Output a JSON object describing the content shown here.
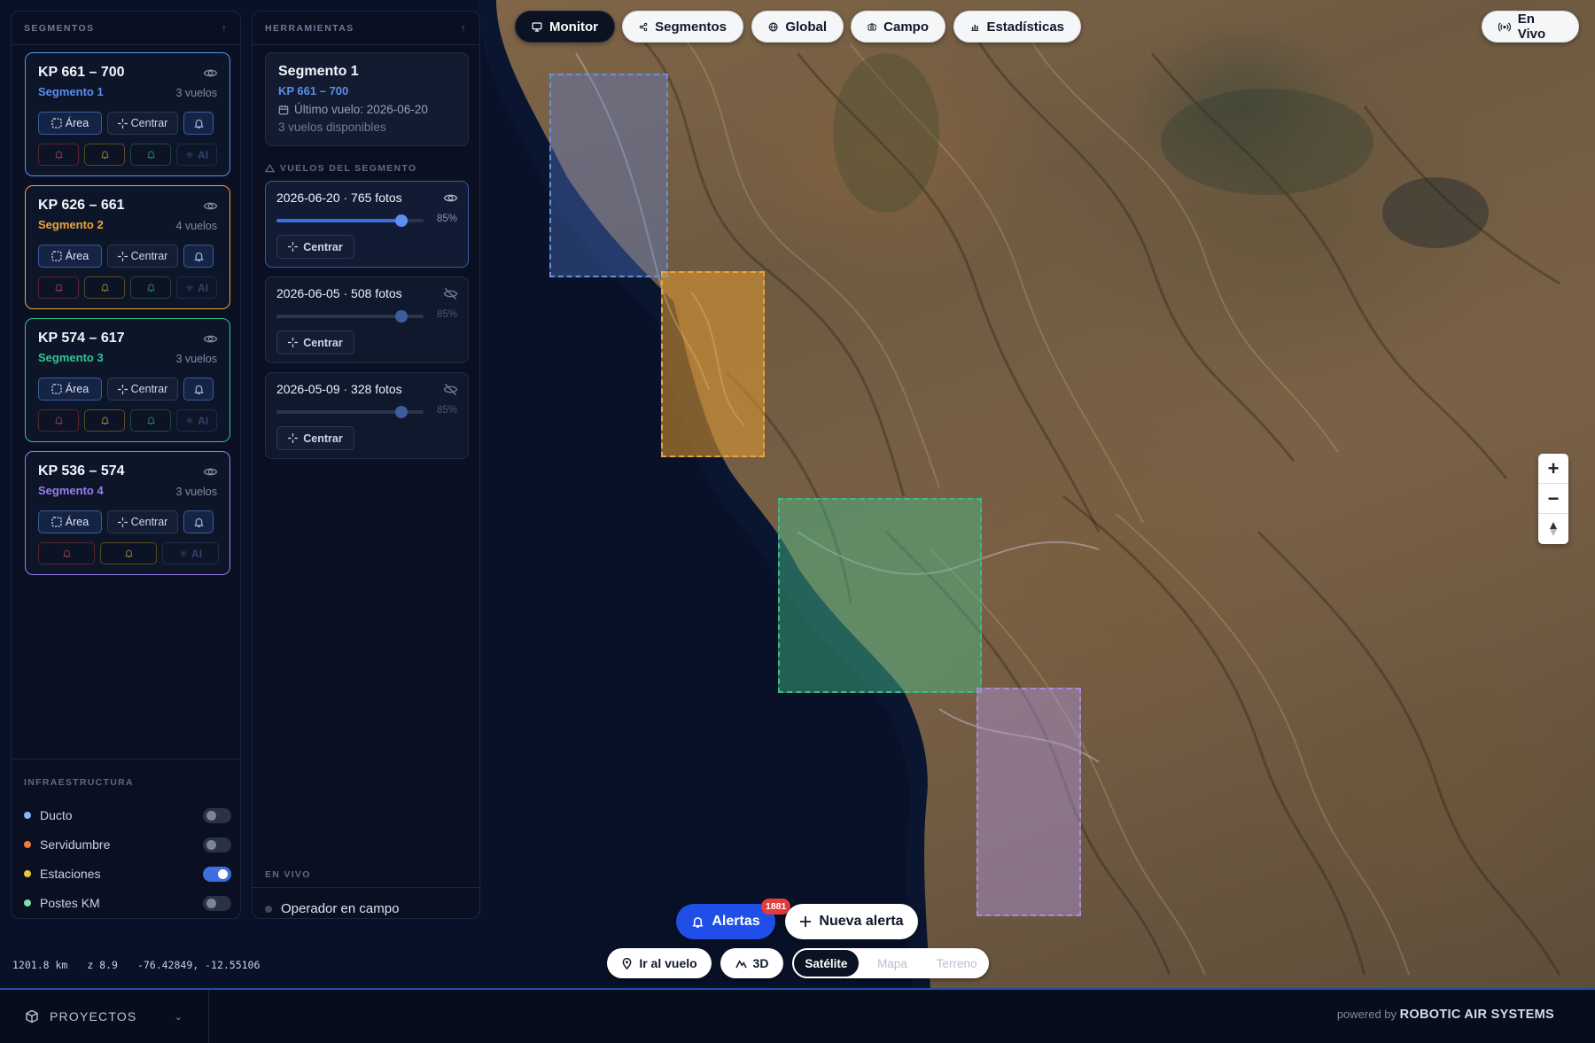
{
  "top_nav": {
    "tabs": [
      {
        "label": "Monitor",
        "icon": "monitor-icon",
        "active": true
      },
      {
        "label": "Segmentos",
        "icon": "share-icon",
        "active": false
      },
      {
        "label": "Global",
        "icon": "globe-icon",
        "active": false
      },
      {
        "label": "Campo",
        "icon": "camera-icon",
        "active": false
      },
      {
        "label": "Estadísticas",
        "icon": "bar-chart-icon",
        "active": false
      }
    ],
    "live_button": "En Vivo"
  },
  "segments_panel": {
    "title": "SEGMENTOS",
    "area_label": "Área",
    "center_label": "Centrar",
    "ai_label": "AI",
    "segments": [
      {
        "kp": "KP 661 – 700",
        "name": "Segmento 1",
        "flights": "3 vuelos",
        "color": "#5b8ef0"
      },
      {
        "kp": "KP 626 – 661",
        "name": "Segmento 2",
        "flights": "4 vuelos",
        "color": "#f0a43a"
      },
      {
        "kp": "KP 574 – 617",
        "name": "Segmento 3",
        "flights": "3 vuelos",
        "color": "#35c48d"
      },
      {
        "kp": "KP 536 – 574",
        "name": "Segmento 4",
        "flights": "3 vuelos",
        "color": "#9a7cf0"
      }
    ],
    "infra_title": "INFRAESTRUCTURA",
    "infra_items": [
      {
        "label": "Ducto",
        "color": "#8fb3f5",
        "on": false
      },
      {
        "label": "Servidumbre",
        "color": "#f07a3a",
        "on": false
      },
      {
        "label": "Estaciones",
        "color": "#f0c43a",
        "on": true
      },
      {
        "label": "Postes KM",
        "color": "#7ee0a6",
        "on": false
      }
    ]
  },
  "tools_panel": {
    "title": "HERRAMIENTAS",
    "selected": {
      "name": "Segmento 1",
      "kp": "KP 661 – 700",
      "last_flight": "Último vuelo: 2026-06-20",
      "available": "3 vuelos disponibles"
    },
    "flights_title": "VUELOS DEL SEGMENTO",
    "center_label": "Centrar",
    "flights": [
      {
        "title": "2026-06-20 · 765 fotos",
        "opacity": "85%",
        "opacity_value": 0.85,
        "visible": true
      },
      {
        "title": "2026-06-05 · 508 fotos",
        "opacity": "85%",
        "opacity_value": 0.85,
        "visible": false
      },
      {
        "title": "2026-05-09 · 328 fotos",
        "opacity": "85%",
        "opacity_value": 0.85,
        "visible": false
      }
    ],
    "live_title": "EN VIVO",
    "operator": "Operador en campo"
  },
  "map_controls": {
    "alerts_label": "Alertas",
    "alerts_count": "1881",
    "new_alert_label": "Nueva alerta",
    "goto_flight_label": "Ir al vuelo",
    "three_d_label": "3D",
    "map_types": [
      "Satélite",
      "Mapa",
      "Terreno"
    ],
    "active_map_type": "Satélite"
  },
  "status": {
    "distance": "1201.8 km",
    "zoom": "z 8.9",
    "coordinates": "-76.42849, -12.55106"
  },
  "footer": {
    "projects_label": "PROYECTOS",
    "powered_prefix": "powered by",
    "powered_brand": "ROBOTIC AIR SYSTEMS"
  }
}
